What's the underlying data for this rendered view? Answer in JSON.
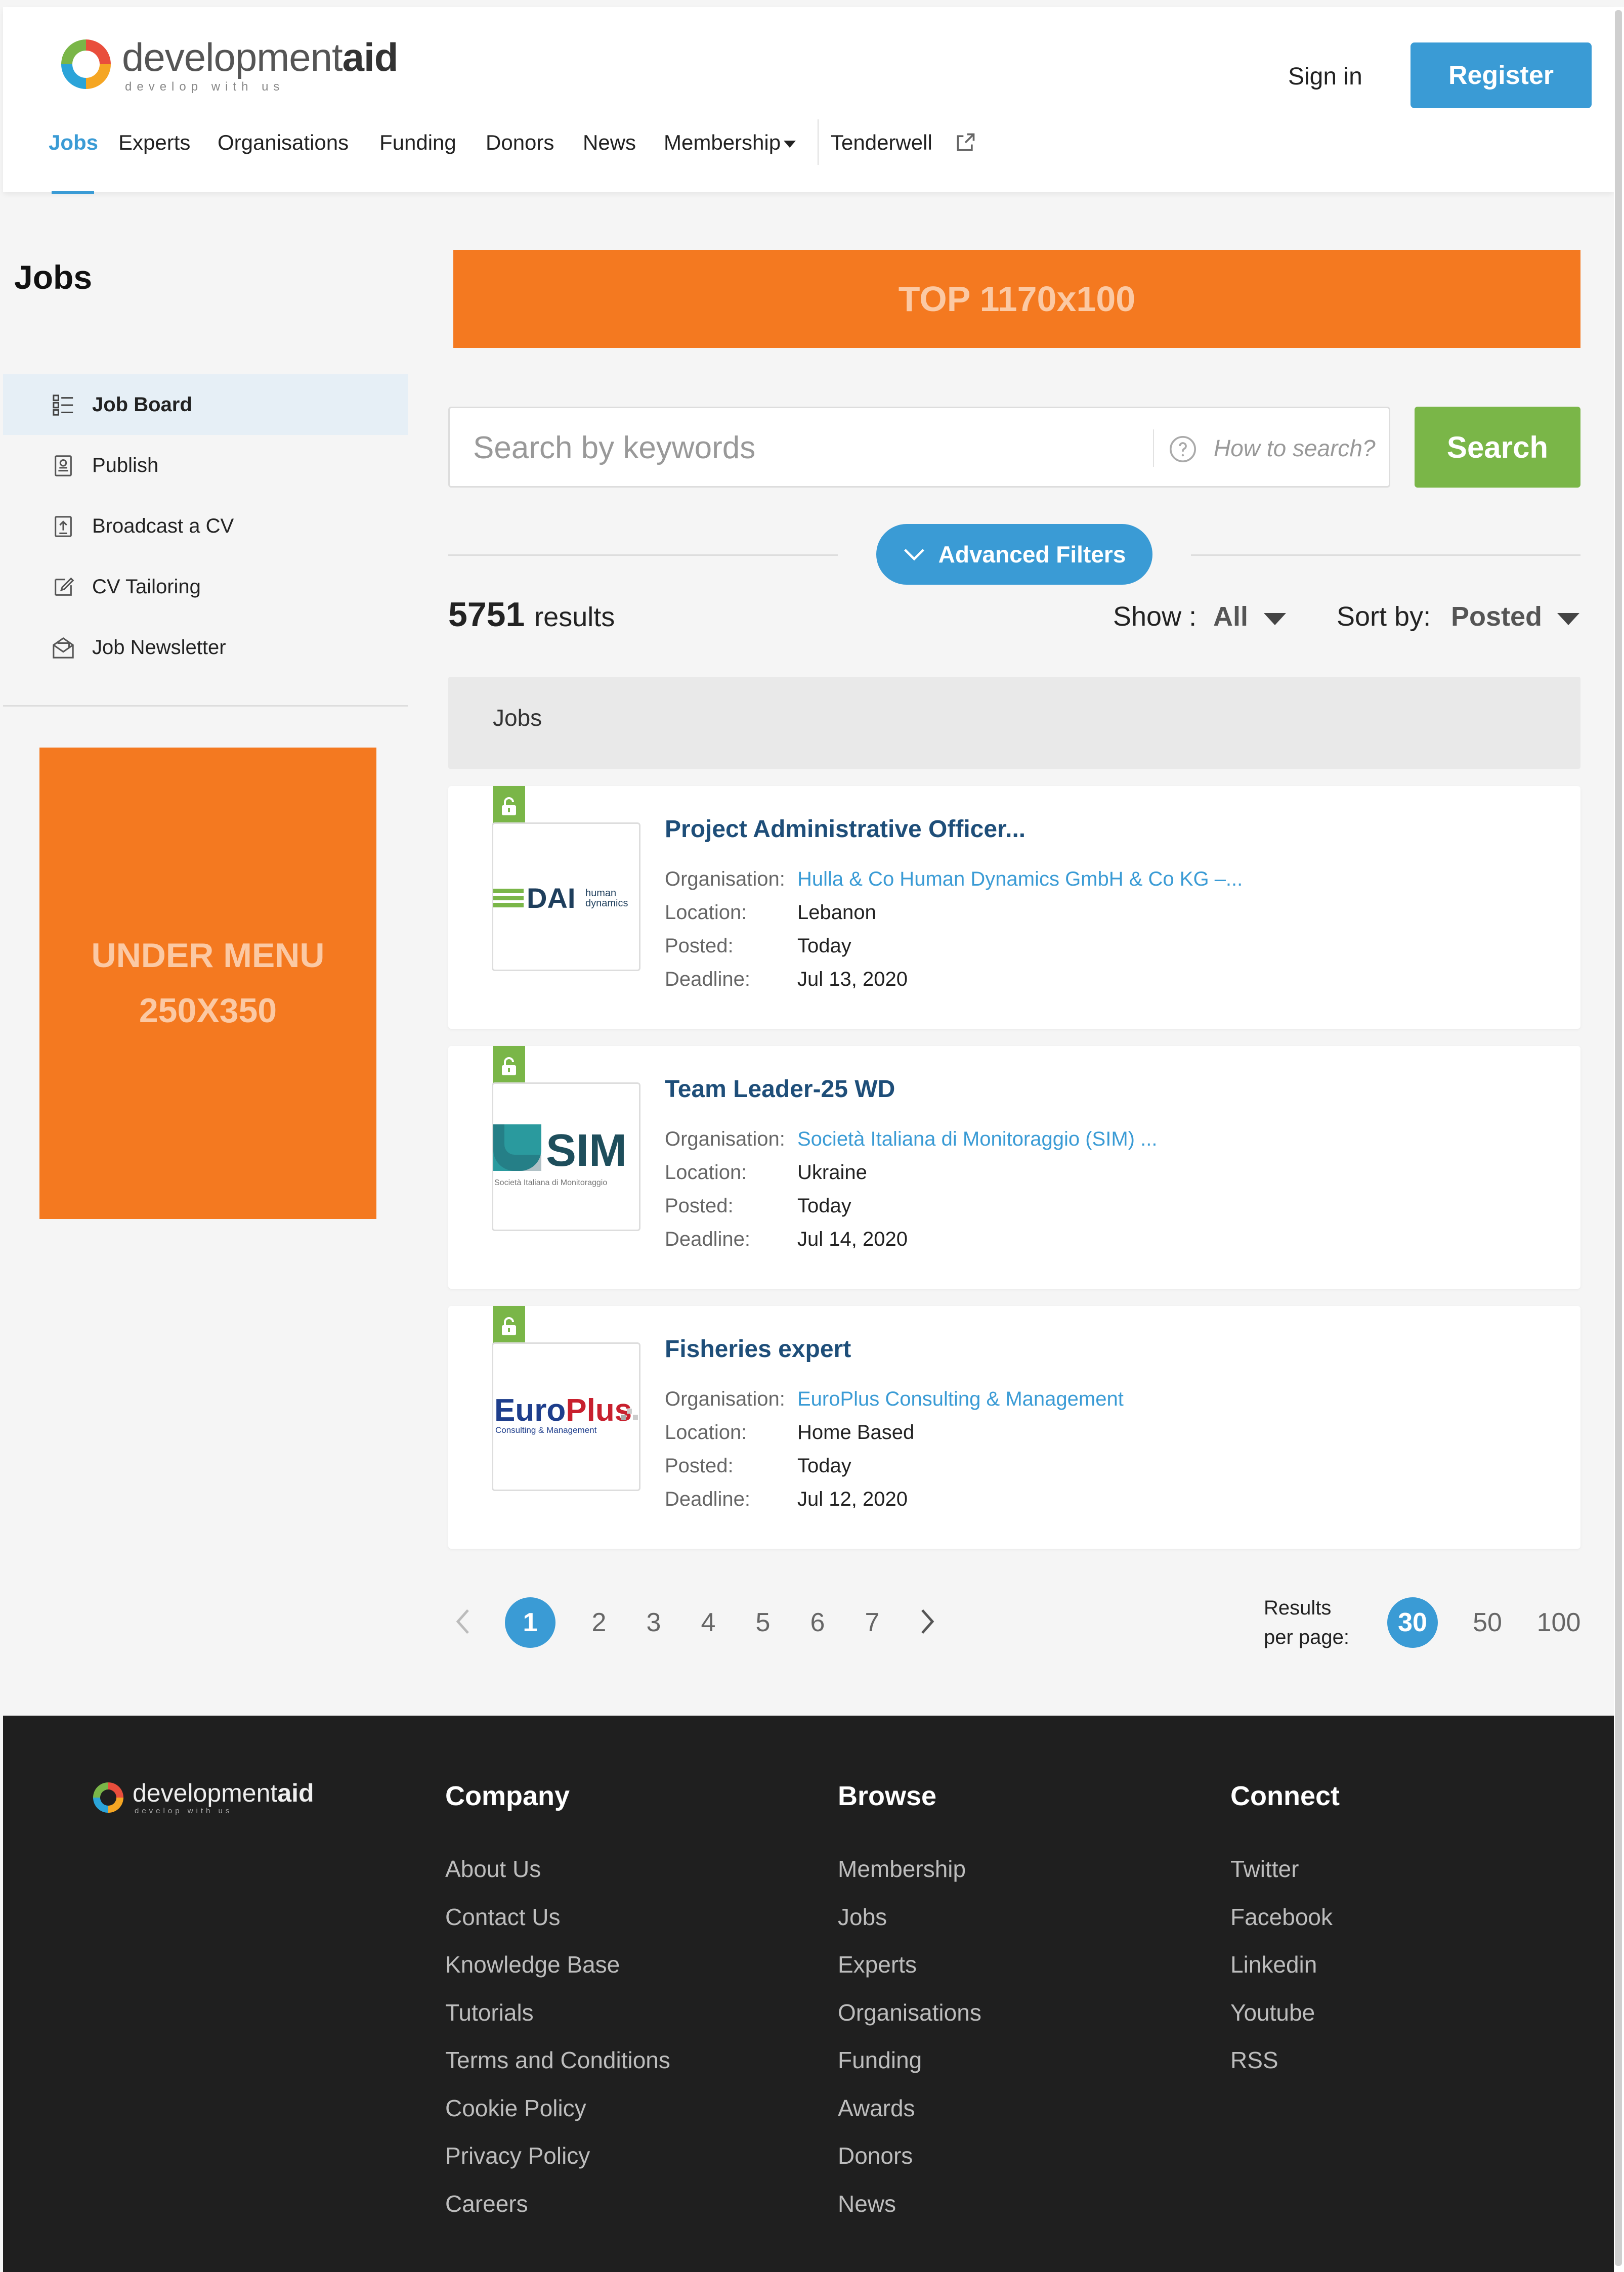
{
  "header": {
    "logo_word": "development",
    "logo_word_bold": "aid",
    "logo_tagline": "develop with us",
    "nav": [
      {
        "label": "Jobs",
        "active": true
      },
      {
        "label": "Experts"
      },
      {
        "label": "Organisations"
      },
      {
        "label": "Funding"
      },
      {
        "label": "Donors"
      },
      {
        "label": "News"
      },
      {
        "label": "Membership",
        "dropdown": true
      },
      {
        "label": "Tenderwell",
        "external": true
      }
    ],
    "sign_in": "Sign in",
    "register": "Register",
    "accent": "#3a9bd5"
  },
  "sidebar": {
    "title": "Jobs",
    "items": [
      {
        "label": "Job Board",
        "icon": "list-icon",
        "active": true
      },
      {
        "label": "Publish",
        "icon": "document-icon"
      },
      {
        "label": "Broadcast a CV",
        "icon": "upload-document-icon"
      },
      {
        "label": "CV Tailoring",
        "icon": "edit-icon"
      },
      {
        "label": "Job Newsletter",
        "icon": "newsletter-icon"
      }
    ],
    "ad_line1": "UNDER MENU",
    "ad_line2": "250X350"
  },
  "main": {
    "ad_top": "TOP 1170x100",
    "search": {
      "placeholder": "Search by keywords",
      "how_to": "How to search?",
      "button": "Search"
    },
    "advanced_filters": "Advanced Filters",
    "results_count": "5751",
    "results_word": "results",
    "show_label": "Show :",
    "show_value": "All",
    "sort_label": "Sort by:",
    "sort_value": "Posted",
    "jobs_header": "Jobs",
    "field_labels": {
      "organisation": "Organisation:",
      "location": "Location:",
      "posted": "Posted:",
      "deadline": "Deadline:"
    },
    "jobs": [
      {
        "title": "Project Administrative Officer...",
        "organisation": "Hulla & Co Human Dynamics GmbH & Co KG –...",
        "location": "Lebanon",
        "posted": "Today",
        "deadline": "Jul 13, 2020",
        "logo_text": "DAI",
        "logo_sub1": "human",
        "logo_sub2": "dynamics"
      },
      {
        "title": "Team Leader-25 WD",
        "organisation": "Società Italiana di Monitoraggio (SIM) ...",
        "location": "Ukraine",
        "posted": "Today",
        "deadline": "Jul 14, 2020",
        "logo_text": "SIM",
        "logo_sub1": "Società Italiana di Monitoraggio"
      },
      {
        "title": "Fisheries expert",
        "organisation": "EuroPlus Consulting & Management",
        "location": "Home Based",
        "posted": "Today",
        "deadline": "Jul 12, 2020",
        "logo_text_a": "Euro",
        "logo_text_b": "Plus",
        "logo_sub1": "Consulting & Management"
      }
    ],
    "pagination": {
      "pages": [
        "1",
        "2",
        "3",
        "4",
        "5",
        "6",
        "7"
      ],
      "current": "1",
      "results_per_page_line1": "Results",
      "results_per_page_line2": "per page:",
      "per_page_options": [
        "30",
        "50",
        "100"
      ],
      "per_page_current": "30"
    }
  },
  "footer": {
    "logo_word": "development",
    "logo_word_bold": "aid",
    "logo_tagline": "develop with us",
    "columns": [
      {
        "heading": "Company",
        "links": [
          "About Us",
          "Contact Us",
          "Knowledge Base",
          "Tutorials",
          "Terms and Conditions",
          "Cookie Policy",
          "Privacy Policy",
          "Careers"
        ]
      },
      {
        "heading": "Browse",
        "links": [
          "Membership",
          "Jobs",
          "Experts",
          "Organisations",
          "Funding",
          "Awards",
          "Donors",
          "News"
        ]
      },
      {
        "heading": "Connect",
        "links": [
          "Twitter",
          "Facebook",
          "Linkedin",
          "Youtube",
          "RSS"
        ]
      }
    ]
  }
}
